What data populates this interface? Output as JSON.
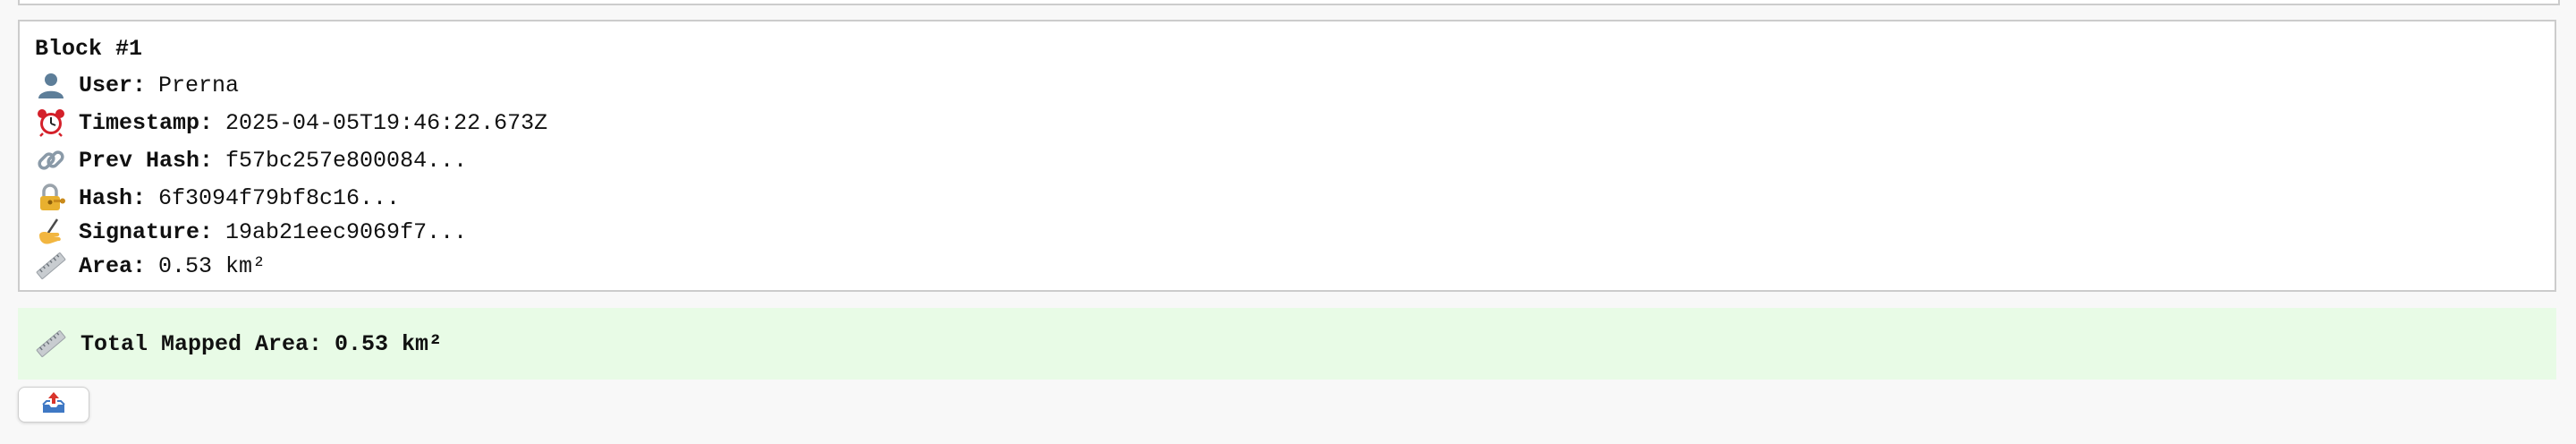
{
  "block": {
    "title": "Block #1",
    "user_label": "User:",
    "user_value": "Prerna",
    "timestamp_label": "Timestamp:",
    "timestamp_value": "2025-04-05T19:46:22.673Z",
    "prev_hash_label": "Prev Hash:",
    "prev_hash_value": "f57bc257e800084...",
    "hash_label": "Hash:",
    "hash_value": "6f3094f79bf8c16...",
    "signature_label": "Signature:",
    "signature_value": "19ab21eec9069f7...",
    "area_label": "Area:",
    "area_value": "0.53 km²"
  },
  "summary": {
    "label": "Total Mapped Area:",
    "value": "0.53 km²",
    "background": "#e8fbe6"
  },
  "icons": {
    "user": "user-silhouette-icon",
    "timestamp": "alarm-clock-icon",
    "prev_hash": "chain-link-icon",
    "hash": "lock-with-key-icon",
    "signature": "writing-hand-icon",
    "area": "ruler-icon",
    "export": "outbox-tray-icon"
  }
}
